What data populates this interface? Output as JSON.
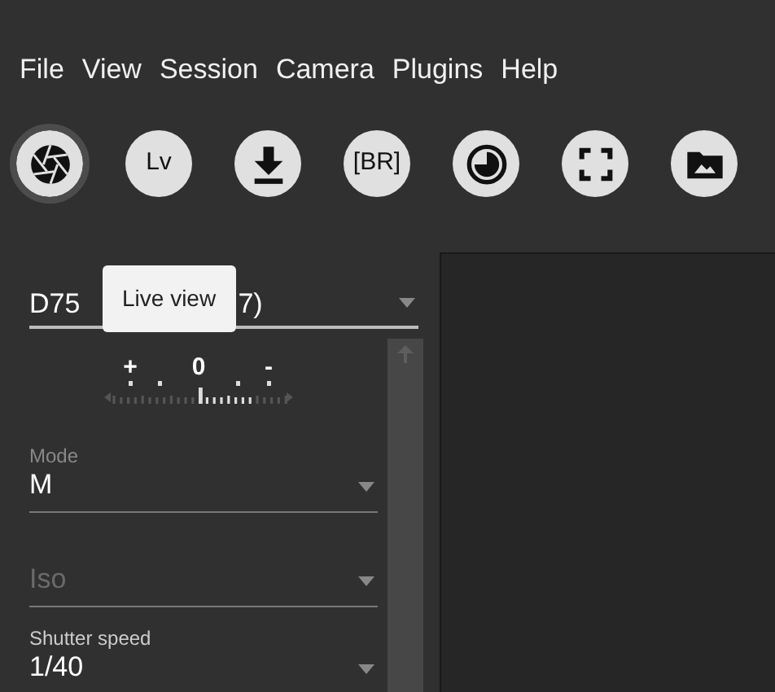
{
  "menu": [
    "File",
    "View",
    "Session",
    "Camera",
    "Plugins",
    "Help"
  ],
  "toolbar": [
    {
      "kind": "aperture",
      "selected": true
    },
    {
      "kind": "text",
      "label": "Lv",
      "selected": false
    },
    {
      "kind": "download",
      "selected": false
    },
    {
      "kind": "text",
      "label": "[BR]",
      "selected": false
    },
    {
      "kind": "timer",
      "selected": false
    },
    {
      "kind": "focus",
      "selected": false
    },
    {
      "kind": "folder",
      "selected": false
    }
  ],
  "tooltip": "Live view",
  "camera_select": {
    "value_start": "D75",
    "value_end": "7)"
  },
  "exposure_meter": {
    "plus": "+",
    "zero": "0",
    "minus": "-"
  },
  "fields": [
    {
      "label": "Mode",
      "value": "M",
      "disabled": false
    },
    {
      "label": "Iso",
      "disabled": true
    },
    {
      "label": "Shutter speed",
      "value": "1/40",
      "disabled": false
    }
  ]
}
